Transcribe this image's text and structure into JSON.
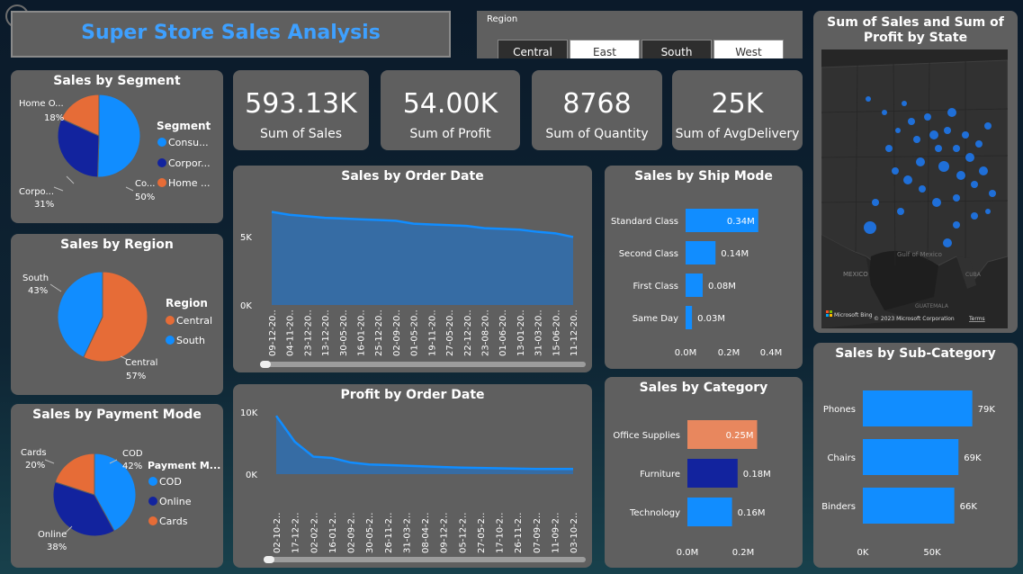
{
  "header": {
    "title": "Super Store Sales Analysis"
  },
  "region_filter": {
    "label": "Region",
    "options": [
      {
        "label": "Central",
        "selected": true
      },
      {
        "label": "East",
        "selected": false
      },
      {
        "label": "South",
        "selected": true
      },
      {
        "label": "West",
        "selected": false
      }
    ]
  },
  "kpis": [
    {
      "value": "593.13K",
      "label": "Sum of Sales"
    },
    {
      "value": "54.00K",
      "label": "Sum of Profit"
    },
    {
      "value": "8768",
      "label": "Sum of Quantity"
    },
    {
      "value": "25K",
      "label": "Sum of AvgDelivery"
    }
  ],
  "colors": {
    "blue": "#118dff",
    "navy": "#12239e",
    "orange": "#e66c37",
    "salmon": "#e8875e",
    "card": "#5f5f5f"
  },
  "segment_chart": {
    "title": "Sales by Segment",
    "legend_title": "Segment",
    "legend": [
      "Consu...",
      "Corpor...",
      "Home ..."
    ],
    "labels": {
      "home_name": "Home O...",
      "home_pct": "18%",
      "corp_name": "Corpo...",
      "corp_pct": "31%",
      "cons_name": "Co...",
      "cons_pct": "50%"
    }
  },
  "region_chart": {
    "title": "Sales by Region",
    "legend_title": "Region",
    "legend": [
      "Central",
      "South"
    ],
    "labels": {
      "south_name": "South",
      "south_pct": "43%",
      "central_name": "Central",
      "central_pct": "57%"
    }
  },
  "payment_chart": {
    "title": "Sales by Payment Mode",
    "legend_title": "Payment M...",
    "legend": [
      "COD",
      "Online",
      "Cards"
    ],
    "labels": {
      "cards_name": "Cards",
      "cards_pct": "20%",
      "cod_name": "COD",
      "cod_pct": "42%",
      "online_name": "Online",
      "online_pct": "38%"
    }
  },
  "sales_date_chart": {
    "title": "Sales by Order Date",
    "y_ticks": [
      "5K",
      "0K"
    ],
    "x_ticks": [
      "09-12-20..",
      "04-11-20..",
      "23-12-20..",
      "13-12-20..",
      "30-05-20..",
      "16-01-20..",
      "25-12-20..",
      "02-09-20..",
      "01-05-20..",
      "19-11-20..",
      "27-05-20..",
      "22-12-20..",
      "23-08-20..",
      "01-06-20..",
      "13-01-20..",
      "31-03-20..",
      "15-06-20..",
      "11-12-20.."
    ]
  },
  "profit_date_chart": {
    "title": "Profit by Order Date",
    "y_ticks": [
      "10K",
      "0K"
    ],
    "x_ticks": [
      "02-10-2..",
      "17-12-2..",
      "02-02-2..",
      "16-01-2..",
      "02-09-2..",
      "30-05-2..",
      "26-11-2..",
      "31-03-2..",
      "08-04-2..",
      "09-12-2..",
      "05-12-2..",
      "27-05-2..",
      "17-10-2..",
      "26-11-2..",
      "07-09-2..",
      "11-09-2..",
      "03-10-2.."
    ]
  },
  "ship_mode_chart": {
    "title": "Sales by Ship Mode",
    "x_ticks": [
      "0.0M",
      "0.2M",
      "0.4M"
    ]
  },
  "category_chart": {
    "title": "Sales by Category",
    "x_ticks": [
      "0.0M",
      "0.2M"
    ]
  },
  "subcategory_chart": {
    "title": "Sales by Sub-Category",
    "x_ticks": [
      "0K",
      "50K"
    ]
  },
  "map": {
    "title": "Sum of Sales and Sum of Profit by State",
    "gulf_label": "Gulf of Mexico",
    "mexico_label": "MEXICO",
    "cuba_label": "CUBA",
    "guatemala_label": "GUATEMALA",
    "attribution": "© 2023 Microsoft Corporation",
    "terms": "Terms",
    "brand": "Microsoft Bing"
  },
  "chart_data": [
    {
      "type": "pie",
      "title": "Sales by Segment",
      "categories": [
        "Consumer",
        "Corporate",
        "Home Office"
      ],
      "values": [
        50,
        31,
        18
      ]
    },
    {
      "type": "pie",
      "title": "Sales by Region",
      "categories": [
        "Central",
        "South"
      ],
      "values": [
        57,
        43
      ]
    },
    {
      "type": "pie",
      "title": "Sales by Payment Mode",
      "categories": [
        "COD",
        "Online",
        "Cards"
      ],
      "values": [
        42,
        38,
        20
      ]
    },
    {
      "type": "area",
      "title": "Sales by Order Date",
      "ylim": [
        0,
        7000
      ],
      "values": [
        6300,
        6100,
        6000,
        5900,
        5850,
        5800,
        5750,
        5700,
        5500,
        5450,
        5400,
        5350,
        5200,
        5150,
        5100,
        4950,
        4850,
        4600
      ]
    },
    {
      "type": "area",
      "title": "Profit by Order Date",
      "ylim": [
        0,
        10000
      ],
      "values": [
        9000,
        5000,
        2700,
        2500,
        1800,
        1500,
        1400,
        1300,
        1200,
        1100,
        1000,
        950,
        900,
        850,
        800,
        800,
        800
      ]
    },
    {
      "type": "bar",
      "title": "Sales by Ship Mode",
      "categories": [
        "Standard Class",
        "Second Class",
        "First Class",
        "Same Day"
      ],
      "values": [
        0.34,
        0.14,
        0.08,
        0.03
      ],
      "labels": [
        "0.34M",
        "0.14M",
        "0.08M",
        "0.03M"
      ],
      "xlim": [
        0,
        0.4
      ]
    },
    {
      "type": "bar",
      "title": "Sales by Category",
      "categories": [
        "Office Supplies",
        "Furniture",
        "Technology"
      ],
      "values": [
        0.25,
        0.18,
        0.16
      ],
      "labels": [
        "0.25M",
        "0.18M",
        "0.16M"
      ],
      "xlim": [
        0,
        0.3
      ]
    },
    {
      "type": "bar",
      "title": "Sales by Sub-Category",
      "categories": [
        "Phones",
        "Chairs",
        "Binders"
      ],
      "values": [
        79,
        69,
        66
      ],
      "labels": [
        "79K",
        "69K",
        "66K"
      ],
      "xlim": [
        0,
        100
      ]
    }
  ]
}
